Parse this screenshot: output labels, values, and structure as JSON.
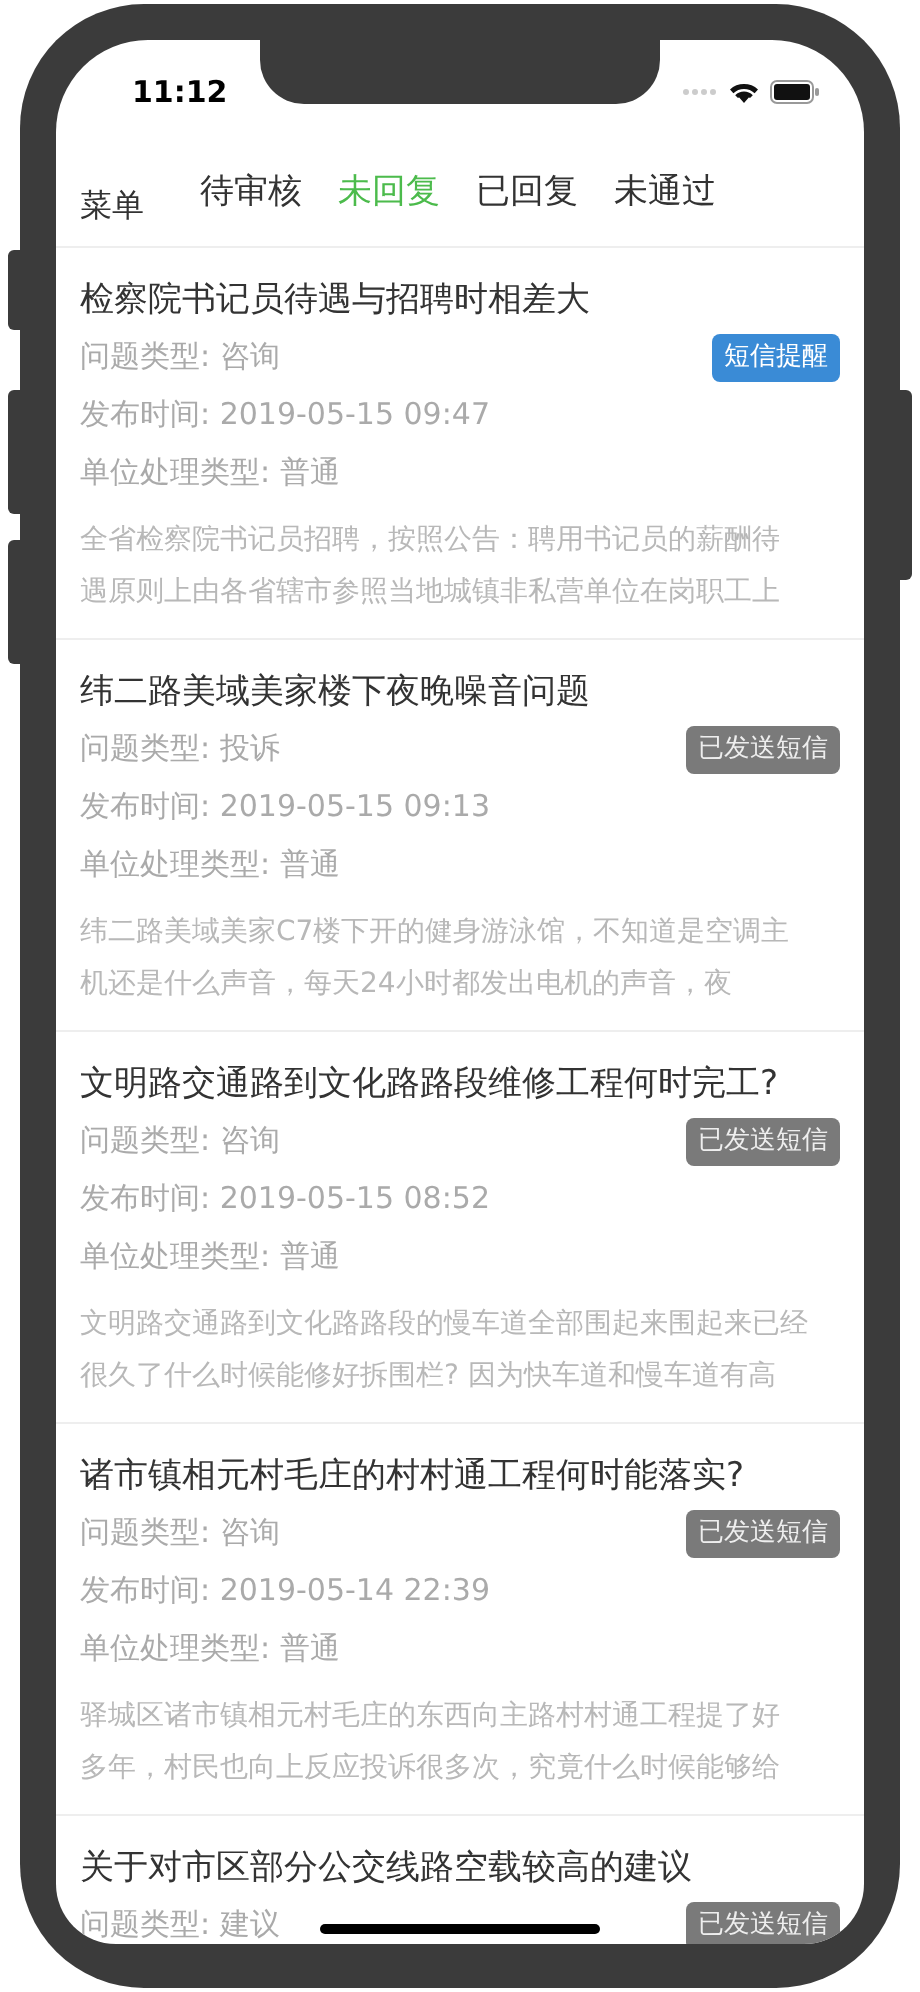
{
  "status_bar": {
    "time": "11:12"
  },
  "menu_label": "菜单",
  "tabs": [
    {
      "label": "待审核",
      "selected": false
    },
    {
      "label": "未回复",
      "selected": true
    },
    {
      "label": "已回复",
      "selected": false
    },
    {
      "label": "未通过",
      "selected": false
    }
  ],
  "items": [
    {
      "title": "检察院书记员待遇与招聘时相差大",
      "type": "问题类型: 咨询",
      "badge": {
        "kind": "remind",
        "label": "短信提醒"
      },
      "time": "发布时间: 2019-05-15 09:47",
      "unit_type": "单位处理类型: 普通",
      "description": [
        "全省检察院书记员招聘，按照公告：聘用书记员的薪酬待",
        "遇原则上由各省辖市参照当地城镇非私营单位在岗职工上"
      ]
    },
    {
      "title": "纬二路美域美家楼下夜晚噪音问题",
      "type": "问题类型: 投诉",
      "badge": {
        "kind": "sent",
        "label": "已发送短信"
      },
      "time": "发布时间: 2019-05-15 09:13",
      "unit_type": "单位处理类型: 普通",
      "description": [
        "纬二路美域美家C7楼下开的健身游泳馆，不知道是空调主",
        "机还是什么声音，每天24小时都发出电机的声音，夜"
      ]
    },
    {
      "title": "文明路交通路到文化路路段维修工程何时完工?",
      "type": "问题类型: 咨询",
      "badge": {
        "kind": "sent",
        "label": "已发送短信"
      },
      "time": "发布时间: 2019-05-15 08:52",
      "unit_type": "单位处理类型: 普通",
      "description": [
        "文明路交通路到文化路路段的慢车道全部围起来围起来已经",
        "很久了什么时候能修好拆围栏? 因为快车道和慢车道有高"
      ]
    },
    {
      "title": "诸市镇相元村毛庄的村村通工程何时能落实?",
      "type": "问题类型: 咨询",
      "badge": {
        "kind": "sent",
        "label": "已发送短信"
      },
      "time": "发布时间: 2019-05-14 22:39",
      "unit_type": "单位处理类型: 普通",
      "description": [
        "驿城区诸市镇相元村毛庄的东西向主路村村通工程提了好",
        "多年，村民也向上反应投诉很多次，究竟什么时候能够给"
      ]
    },
    {
      "title": "关于对市区部分公交线路空载较高的建议",
      "type": "问题类型: 建议",
      "badge": {
        "kind": "sent",
        "label": "已发送短信"
      }
    }
  ]
}
